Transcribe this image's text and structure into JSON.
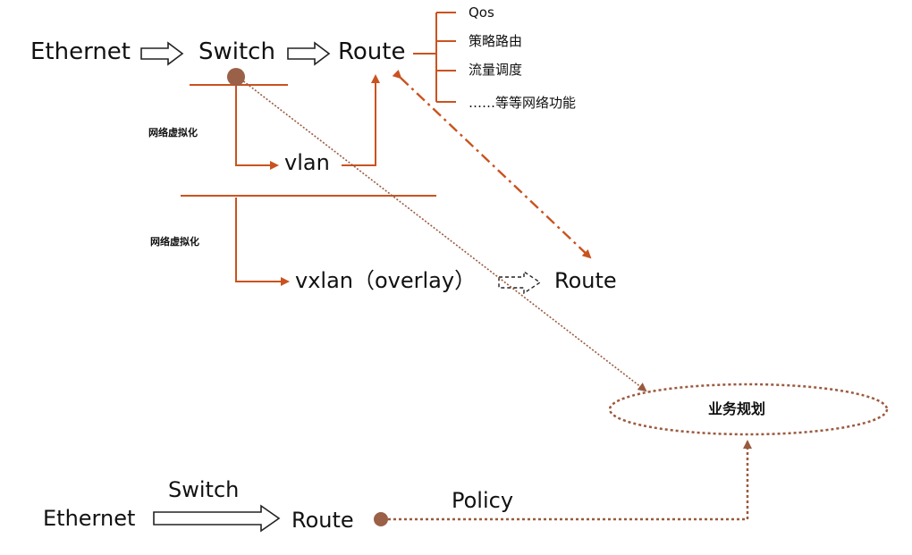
{
  "top": {
    "ethernet": "Ethernet",
    "switch": "Switch",
    "route": "Route"
  },
  "features": [
    "Qos",
    "策略路由",
    "流量调度",
    "……等等网络功能"
  ],
  "virtualization": {
    "label_1": "网络虚拟化",
    "label_2": "网络虚拟化",
    "vlan": "vlan",
    "vxlan": "vxlan（overlay）",
    "vxlan_route": "Route"
  },
  "planning": {
    "oval_label": "业务规划"
  },
  "bottom": {
    "ethernet": "Ethernet",
    "switch": "Switch",
    "route": "Route",
    "policy": "Policy"
  },
  "colors": {
    "accent": "#c9531f",
    "dotted": "#9a5a3f",
    "node": "#9a6048"
  }
}
